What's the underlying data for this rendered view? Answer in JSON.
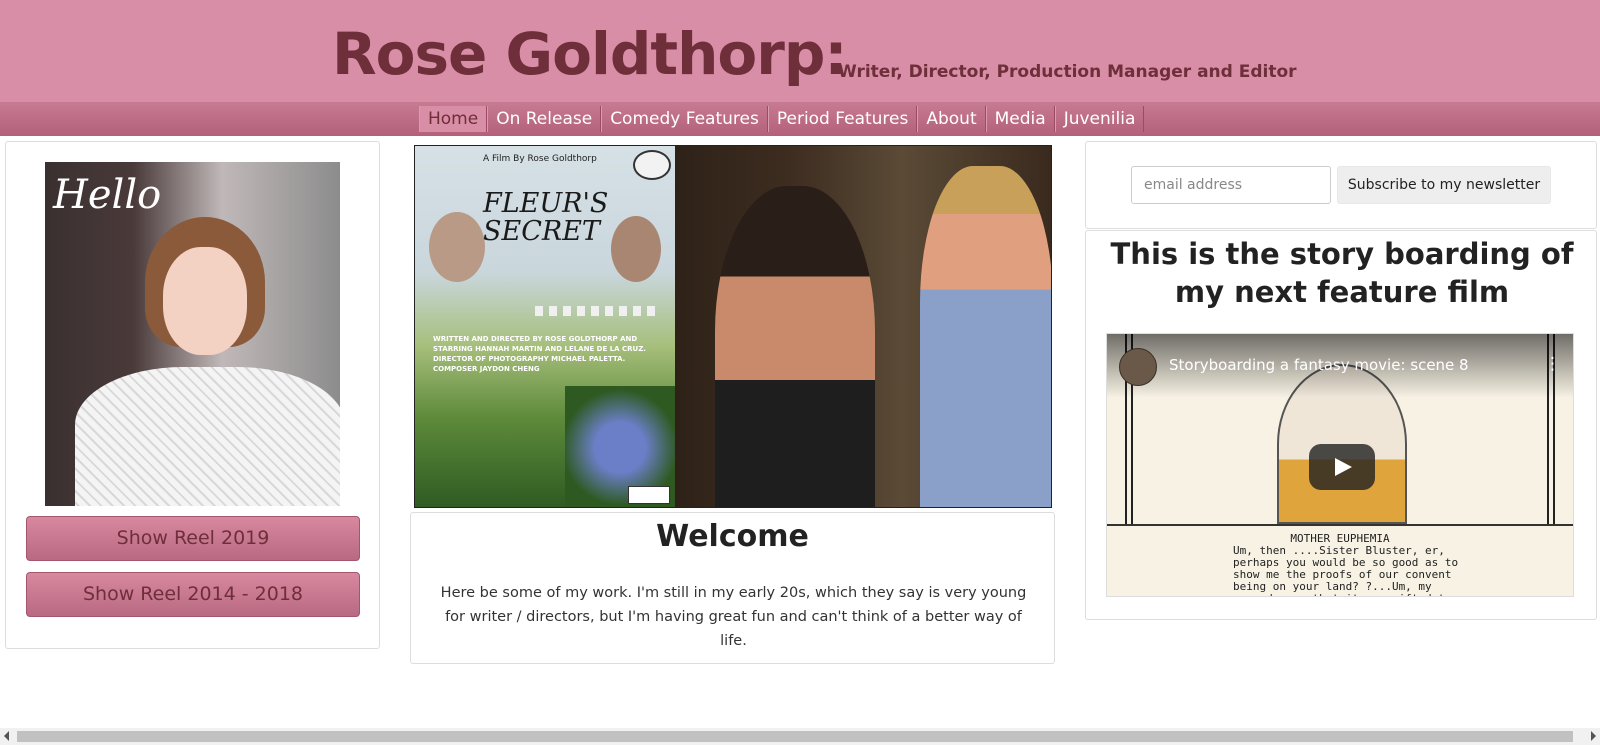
{
  "header": {
    "title": "Rose Goldthorp:",
    "subtitle": "Writer, Director, Production Manager and Editor"
  },
  "nav": {
    "items": [
      {
        "label": "Home",
        "active": true
      },
      {
        "label": "On Release"
      },
      {
        "label": "Comedy Features"
      },
      {
        "label": "Period Features"
      },
      {
        "label": "About"
      },
      {
        "label": "Media"
      },
      {
        "label": "Juvenilia"
      }
    ]
  },
  "left": {
    "portrait_text": "Hello",
    "buttons": {
      "reel1": "Show Reel 2019",
      "reel2": "Show Reel 2014 - 2018"
    }
  },
  "hero": {
    "poster": {
      "credit": "A Film By Rose Goldthorp",
      "title": "FLEUR'S SECRET",
      "credits_text": "WRITTEN AND DIRECTED BY ROSE GOLDTHORP AND STARRING HANNAH MARTIN AND LELANE DE LA CRUZ. DIRECTOR OF PHOTOGRAPHY MICHAEL PALETTA. COMPOSER JAYDON CHENG"
    }
  },
  "welcome": {
    "title": "Welcome",
    "text": "Here be some of my work. I'm still in my early 20s, which they say is very young for writer / directors, but I'm having great fun and can't think of a better way of life."
  },
  "subscribe": {
    "placeholder": "email address",
    "button": "Subscribe to my newsletter"
  },
  "story": {
    "heading": "This is the story boarding of my next feature film",
    "video": {
      "title": "Storyboarding a fantasy movie: scene 8",
      "menu_icon": "kebab-menu-icon",
      "character": "MOTHER EUPHEMIA",
      "dialogue": "Um, then ....Sister Bluster, er, perhaps you would be so good as to show me the proofs of our convent being on your land? ?...Um, my records say that it was gifted to"
    }
  },
  "colors": {
    "header_bg": "#d88ea6",
    "title_color": "#6e2e3a",
    "nav_bg": "#b4607a",
    "button_bg": "#c77b92"
  }
}
